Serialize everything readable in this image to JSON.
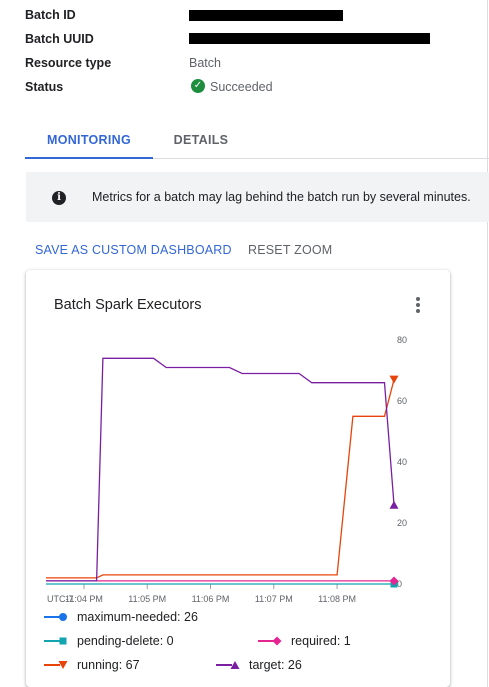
{
  "properties": {
    "batch_id_label": "Batch ID",
    "batch_uuid_label": "Batch UUID",
    "resource_type_label": "Resource type",
    "resource_type_value": "Batch",
    "status_label": "Status",
    "status_value": "Succeeded"
  },
  "tabs": {
    "monitoring": "MONITORING",
    "details": "DETAILS"
  },
  "banner": {
    "icon": "info-icon",
    "text": "Metrics for a batch may lag behind the batch run by several minutes."
  },
  "actions": {
    "save": "SAVE AS CUSTOM DASHBOARD",
    "reset": "RESET ZOOM"
  },
  "chart_card": {
    "title": "Batch Spark Executors",
    "menu_icon": "more-vert-icon"
  },
  "chart_data": {
    "type": "line",
    "title": "Batch Spark Executors",
    "timezone_label": "UTC-7",
    "x_ticks": [
      "11:04 PM",
      "11:05 PM",
      "11:06 PM",
      "11:07 PM",
      "11:08 PM"
    ],
    "x_tick_minutes": [
      0,
      1,
      2,
      3,
      4
    ],
    "xlim_minutes": [
      -0.6,
      4.9
    ],
    "y_ticks": [
      0,
      20,
      40,
      60,
      80
    ],
    "ylim": [
      0,
      80
    ],
    "y_axis_side": "right",
    "grid": false,
    "legend_placement": "bottom",
    "series": [
      {
        "name": "maximum-needed",
        "color": "#1a73e8",
        "marker": "circle",
        "latest": 26,
        "x": [],
        "y": []
      },
      {
        "name": "pending-delete",
        "color": "#12a4af",
        "marker": "square",
        "latest": 0,
        "x": [
          -0.6,
          4.9
        ],
        "y": [
          0,
          0
        ]
      },
      {
        "name": "required",
        "color": "#e52592",
        "marker": "diamond",
        "latest": 1,
        "x": [
          -0.6,
          4.9
        ],
        "y": [
          1,
          1
        ]
      },
      {
        "name": "running",
        "color": "#e8430a",
        "marker": "triangle-down",
        "latest": 67,
        "x": [
          -0.6,
          0.2,
          0.3,
          4.0,
          4.25,
          4.75,
          4.9
        ],
        "y": [
          2,
          2,
          3,
          3,
          55,
          55,
          67
        ]
      },
      {
        "name": "target",
        "color": "#7b1fa2",
        "marker": "triangle-up",
        "latest": 26,
        "x": [
          -0.6,
          0.2,
          0.3,
          1.1,
          1.3,
          2.3,
          2.5,
          3.4,
          3.6,
          4.75,
          4.9
        ],
        "y": [
          1,
          1,
          74,
          74,
          71,
          71,
          69,
          69,
          66,
          66,
          26
        ]
      }
    ]
  }
}
